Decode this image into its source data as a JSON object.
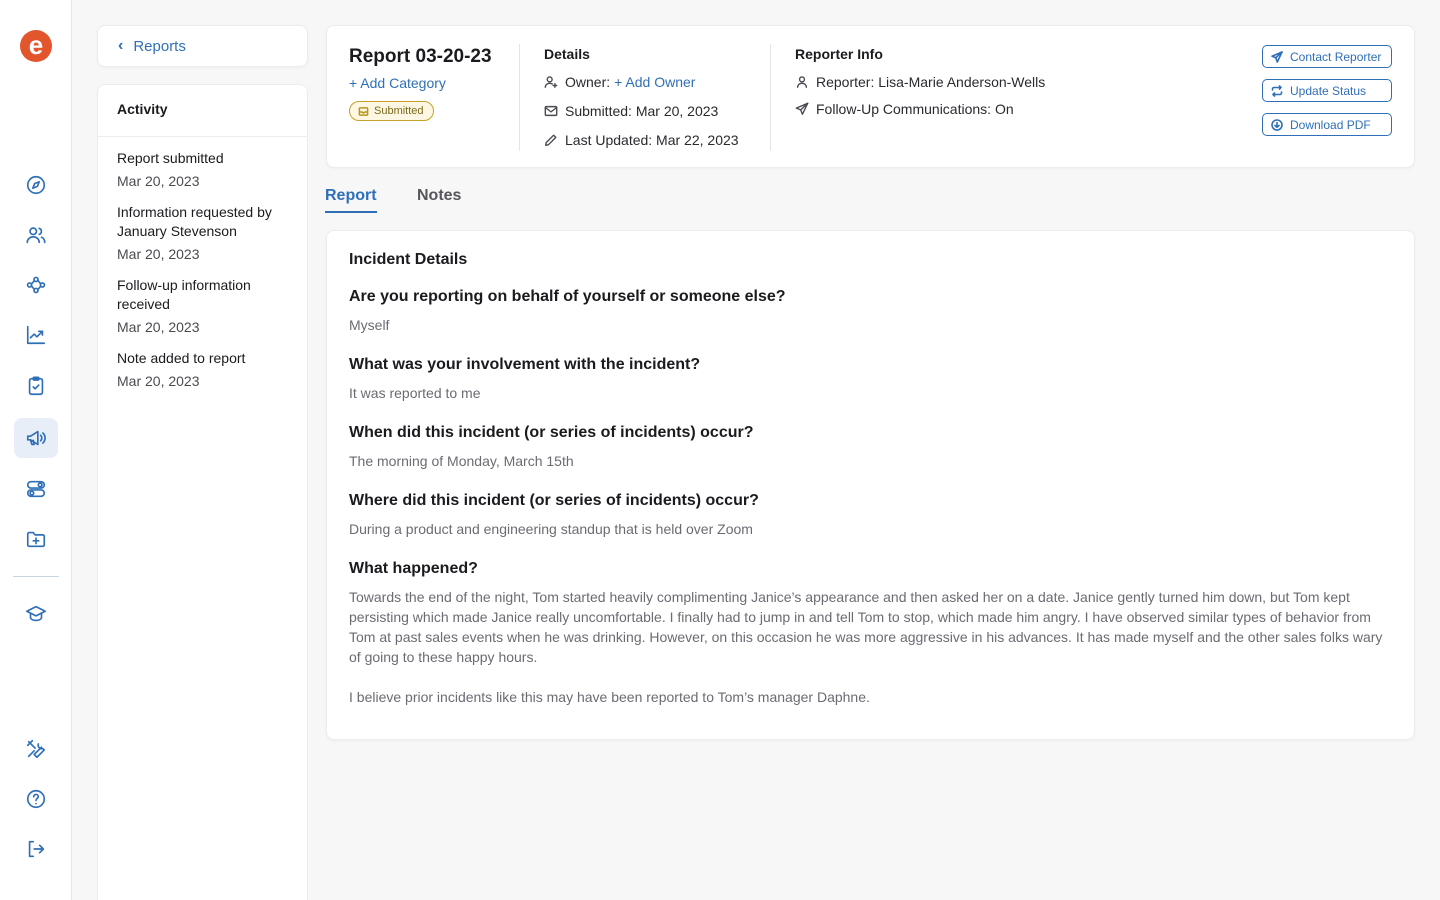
{
  "brand": {
    "logo_letter": "e",
    "accent": "#2f6fb8",
    "logo_color": "#e2552d"
  },
  "rail": {
    "items": [
      {
        "icon": "compass-icon"
      },
      {
        "icon": "users-icon"
      },
      {
        "icon": "workflow-icon"
      },
      {
        "icon": "trend-chart-icon"
      },
      {
        "icon": "clipboard-check-icon"
      },
      {
        "icon": "megaphone-icon",
        "active": true
      },
      {
        "icon": "toggles-icon"
      },
      {
        "icon": "folder-plus-icon"
      },
      {
        "icon": "graduation-cap-icon"
      }
    ],
    "bottom": [
      {
        "icon": "tools-icon"
      },
      {
        "icon": "help-icon"
      },
      {
        "icon": "logout-icon"
      }
    ]
  },
  "back": {
    "label": "Reports"
  },
  "activity": {
    "title": "Activity",
    "items": [
      {
        "title": "Report submitted",
        "date": "Mar 20, 2023"
      },
      {
        "title": "Information requested by January Stevenson",
        "date": "Mar 20, 2023"
      },
      {
        "title": "Follow-up information received",
        "date": "Mar 20, 2023"
      },
      {
        "title": "Note added to report",
        "date": "Mar 20, 2023"
      }
    ]
  },
  "report": {
    "title": "Report 03-20-23",
    "add_category": "+ Add Category",
    "status": "Submitted",
    "status_color": "#c9a227"
  },
  "details": {
    "title": "Details",
    "owner_label": "Owner:",
    "owner_link": "+ Add Owner",
    "submitted": "Submitted: Mar 20, 2023",
    "updated": "Last Updated: Mar 22, 2023"
  },
  "reporter": {
    "title": "Reporter Info",
    "name": "Reporter: Lisa-Marie Anderson-Wells",
    "followup": "Follow-Up Communications: On"
  },
  "actions": {
    "contact": "Contact Reporter",
    "update": "Update Status",
    "download": "Download PDF"
  },
  "tabs": {
    "report": "Report",
    "notes": "Notes"
  },
  "incident": {
    "title": "Incident Details",
    "qa": [
      {
        "q": "Are you reporting on behalf of yourself or someone else?",
        "a": "Myself"
      },
      {
        "q": "What was your involvement with the incident?",
        "a": "It was reported to me"
      },
      {
        "q": "When did this incident (or series of incidents) occur?",
        "a": "The morning of Monday, March 15th"
      },
      {
        "q": "Where did this incident (or series of incidents) occur?",
        "a": "During a product and engineering standup that is held over Zoom"
      },
      {
        "q": "What happened?",
        "a": "Towards the end of the night, Tom started heavily complimenting Janice’s appearance and then asked her on a date. Janice gently turned him down, but Tom kept persisting which made Janice really uncomfortable. I finally had to jump in and tell Tom to stop, which made him angry. I have observed similar types of behavior from Tom at past sales events when he was drinking. However, on this occasion he was more aggressive in his advances. It has made myself and the other sales folks wary of going to these happy hours."
      }
    ],
    "extra_paragraph": "I believe prior incidents like this may have been reported to Tom’s manager Daphne."
  }
}
